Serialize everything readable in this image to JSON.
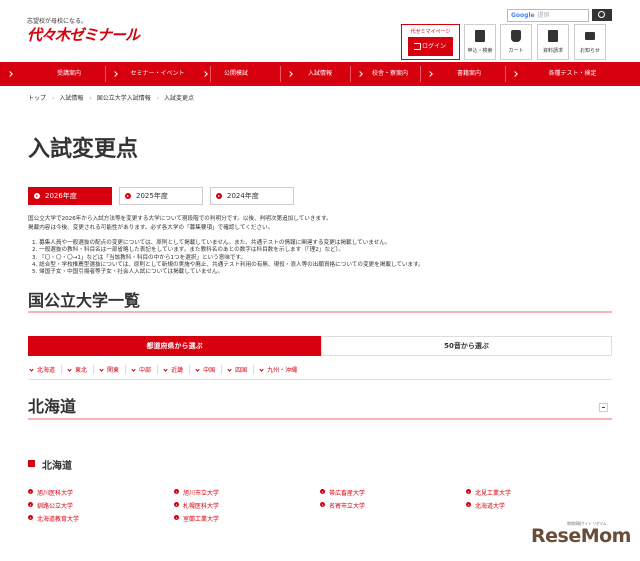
{
  "header": {
    "tagline": "志望校が母校になる。",
    "logo": "代々木ゼミナール",
    "google_label": "Google",
    "search_placeholder": "提供",
    "mypage_title": "代ゼミマイページ",
    "login_label": "ログイン",
    "icons": [
      {
        "icon": "document-icon",
        "label": "申込・検索"
      },
      {
        "icon": "cart-icon",
        "label": "カート"
      },
      {
        "icon": "book-icon",
        "label": "資料請求"
      },
      {
        "icon": "mail-icon",
        "label": "お知らせ"
      }
    ]
  },
  "nav": [
    "受講案内",
    "セミナー・イベント",
    "公開模試",
    "入試情報",
    "校舎・寮案内",
    "書籍案内",
    "各種テスト・検定"
  ],
  "breadcrumb": [
    "トップ",
    "入試情報",
    "国公立大学入試情報",
    "入試変更点"
  ],
  "page_title": "入試変更点",
  "year_tabs": [
    "2026年度",
    "2025年度",
    "2024年度"
  ],
  "intro": [
    "国公立大学で2026年から入試方法等を変更する大学について現段階での判明分です。以後、判明次第追加していきます。",
    "掲載内容は今後、変更される可能性があります。必ず各大学の「募集要項」で確認してください。"
  ],
  "notes": [
    "1. 募集人員や一般選抜の配点の変更については、原則として掲載していません。また、共通テストの情報に関連する変更は掲載していません。",
    "2. 一般選抜の教科・科目名は一部省略した表記をしています。また教科名のあとの数字は科目数を示します（「理2」など）。",
    "3. 「〇・〇・〇→1」などは「当該教科・科目の中から1つを選択」という意味です。",
    "4. 総合型・学校推薦型選抜については、原則として新規の実施や廃止、共通テスト利用の有無、現役・浪人等の出願資格についての変更を掲載しています。",
    "5. 帰国子女・中国引揚者等子女・社会人入試については掲載していません。"
  ],
  "section_title": "国公立大学一覧",
  "select_tabs": [
    "都道府県から選ぶ",
    "50音から選ぶ"
  ],
  "regions": [
    "北海道",
    "東北",
    "関東",
    "中部",
    "近畿",
    "中国",
    "四国",
    "九州・沖縄"
  ],
  "area_title": "北海道",
  "prefecture": "北海道",
  "universities": [
    [
      "旭川医科大学",
      "旭川市立大学",
      "帯広畜産大学",
      "北見工業大学"
    ],
    [
      "釧路公立大学",
      "札幌医科大学",
      "名寄市立大学",
      "北海道大学"
    ],
    [
      "北海道教育大学",
      "室蘭工業大学"
    ]
  ],
  "watermark": "ReseMom",
  "watermark_tag": "教育情報サイト リセマム"
}
